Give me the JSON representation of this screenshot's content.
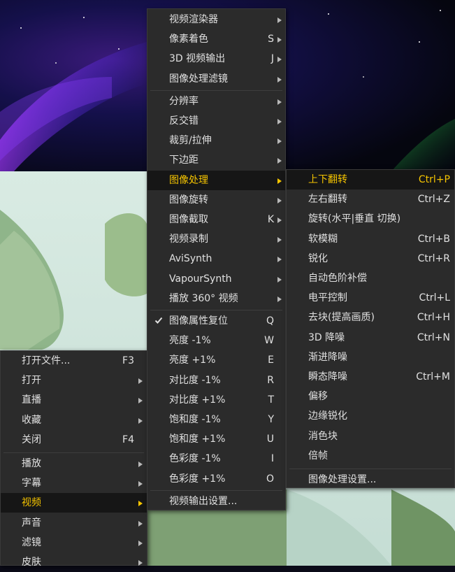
{
  "menu_main": {
    "items": [
      {
        "label": "打开文件...",
        "shortcut": "F3",
        "sub": false
      },
      {
        "label": "打开",
        "shortcut": "",
        "sub": true
      },
      {
        "label": "直播",
        "shortcut": "",
        "sub": true
      },
      {
        "label": "收藏",
        "shortcut": "",
        "sub": true
      },
      {
        "label": "关闭",
        "shortcut": "F4",
        "sub": false
      },
      {
        "label": "播放",
        "shortcut": "",
        "sub": true
      },
      {
        "label": "字幕",
        "shortcut": "",
        "sub": true
      },
      {
        "label": "视频",
        "shortcut": "",
        "sub": true,
        "active": true
      },
      {
        "label": "声音",
        "shortcut": "",
        "sub": true
      },
      {
        "label": "滤镜",
        "shortcut": "",
        "sub": true
      },
      {
        "label": "皮肤",
        "shortcut": "",
        "sub": true
      }
    ]
  },
  "menu_video": {
    "items": [
      {
        "label": "视频渲染器",
        "shortcut": "",
        "sub": true
      },
      {
        "label": "像素着色",
        "shortcut": "S",
        "sub": true
      },
      {
        "label": "3D 视频输出",
        "shortcut": "J",
        "sub": true
      },
      {
        "label": "图像处理滤镜",
        "shortcut": "",
        "sub": true
      },
      {
        "label": "分辨率",
        "shortcut": "",
        "sub": true
      },
      {
        "label": "反交错",
        "shortcut": "",
        "sub": true
      },
      {
        "label": "裁剪/拉伸",
        "shortcut": "",
        "sub": true
      },
      {
        "label": "下边距",
        "shortcut": "",
        "sub": true
      },
      {
        "label": "图像处理",
        "shortcut": "",
        "sub": true,
        "active": true
      },
      {
        "label": "图像旋转",
        "shortcut": "",
        "sub": true
      },
      {
        "label": "图像截取",
        "shortcut": "K",
        "sub": true
      },
      {
        "label": "视频录制",
        "shortcut": "",
        "sub": true
      },
      {
        "label": "AviSynth",
        "shortcut": "",
        "sub": true
      },
      {
        "label": "VapourSynth",
        "shortcut": "",
        "sub": true
      },
      {
        "label": "播放 360° 视频",
        "shortcut": "",
        "sub": true
      },
      {
        "label": "图像属性复位",
        "shortcut": "Q",
        "sub": false,
        "checked": true
      },
      {
        "label": "亮度 -1%",
        "shortcut": "W",
        "sub": false
      },
      {
        "label": "亮度 +1%",
        "shortcut": "E",
        "sub": false
      },
      {
        "label": "对比度 -1%",
        "shortcut": "R",
        "sub": false
      },
      {
        "label": "对比度 +1%",
        "shortcut": "T",
        "sub": false
      },
      {
        "label": "饱和度 -1%",
        "shortcut": "Y",
        "sub": false
      },
      {
        "label": "饱和度 +1%",
        "shortcut": "U",
        "sub": false
      },
      {
        "label": "色彩度 -1%",
        "shortcut": "I",
        "sub": false
      },
      {
        "label": "色彩度 +1%",
        "shortcut": "O",
        "sub": false
      },
      {
        "label": "视频输出设置...",
        "shortcut": "",
        "sub": false
      }
    ]
  },
  "menu_image": {
    "items": [
      {
        "label": "上下翻转",
        "shortcut": "Ctrl+P",
        "active": true
      },
      {
        "label": "左右翻转",
        "shortcut": "Ctrl+Z"
      },
      {
        "label": "旋转(水平|垂直 切换)",
        "shortcut": ""
      },
      {
        "label": "软模糊",
        "shortcut": "Ctrl+B"
      },
      {
        "label": "锐化",
        "shortcut": "Ctrl+R"
      },
      {
        "label": "自动色阶补偿",
        "shortcut": ""
      },
      {
        "label": "电平控制",
        "shortcut": "Ctrl+L"
      },
      {
        "label": "去块(提高画质)",
        "shortcut": "Ctrl+H"
      },
      {
        "label": "3D 降噪",
        "shortcut": "Ctrl+N"
      },
      {
        "label": "渐进降噪",
        "shortcut": ""
      },
      {
        "label": "瞬态降噪",
        "shortcut": "Ctrl+M"
      },
      {
        "label": "偏移",
        "shortcut": ""
      },
      {
        "label": "边缘锐化",
        "shortcut": ""
      },
      {
        "label": "消色块",
        "shortcut": ""
      },
      {
        "label": "倍帧",
        "shortcut": ""
      },
      {
        "label": "图像处理设置...",
        "shortcut": ""
      }
    ]
  },
  "colors": {
    "accent": "#f5c400",
    "menu_bg": "#2b2b2b",
    "highlight_bg": "#161616",
    "text": "#e0e0e0"
  }
}
